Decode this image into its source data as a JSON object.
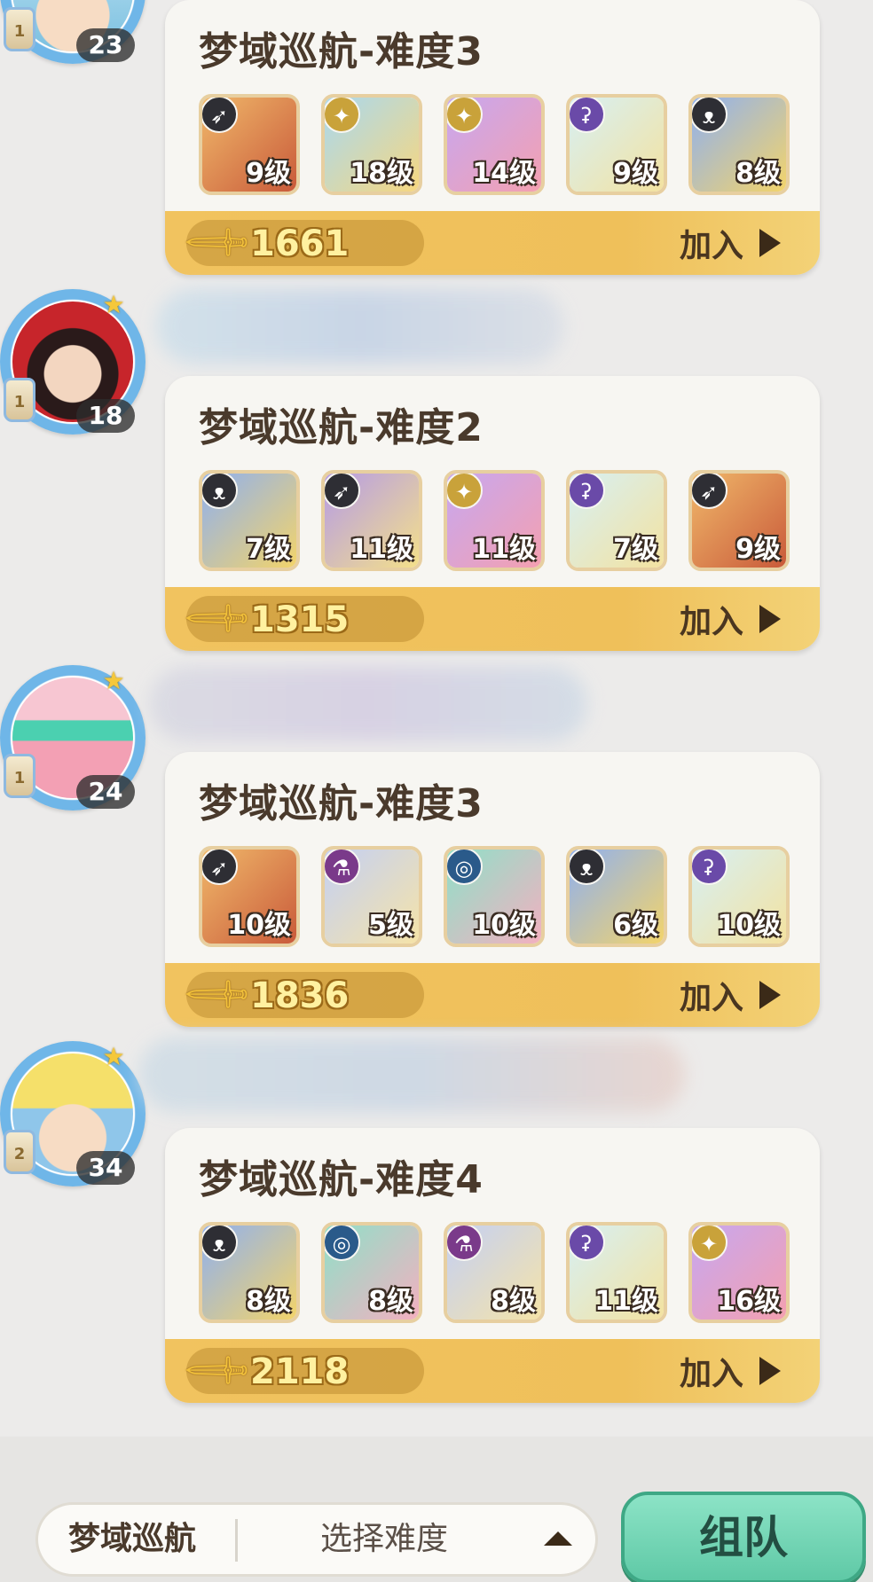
{
  "chat": [
    {
      "sender": {
        "level": "23",
        "bottle": "1"
      },
      "name_blurred": true,
      "card": {
        "title": "梦域巡航-难度3",
        "heroes": [
          {
            "icon": "bow-icon",
            "level": "9级"
          },
          {
            "icon": "wings-icon",
            "level": "18级"
          },
          {
            "icon": "wings-icon",
            "level": "14级"
          },
          {
            "icon": "magic-icon",
            "level": "9级"
          },
          {
            "icon": "cat-icon",
            "level": "8级"
          }
        ],
        "power": "1661",
        "join_label": "加入"
      }
    },
    {
      "sender": {
        "level": "18",
        "bottle": "1"
      },
      "name_blurred": true,
      "card": {
        "title": "梦域巡航-难度2",
        "heroes": [
          {
            "icon": "cat-icon",
            "level": "7级"
          },
          {
            "icon": "bow-icon",
            "level": "11级"
          },
          {
            "icon": "wings-icon",
            "level": "11级"
          },
          {
            "icon": "magic-icon",
            "level": "7级"
          },
          {
            "icon": "bow-icon",
            "level": "9级"
          }
        ],
        "power": "1315",
        "join_label": "加入"
      }
    },
    {
      "sender": {
        "level": "24",
        "bottle": "1"
      },
      "name_blurred": true,
      "card": {
        "title": "梦域巡航-难度3",
        "heroes": [
          {
            "icon": "bow-icon",
            "level": "10级"
          },
          {
            "icon": "potion-icon",
            "level": "5级"
          },
          {
            "icon": "spiral-icon",
            "level": "10级"
          },
          {
            "icon": "cat-icon",
            "level": "6级"
          },
          {
            "icon": "magic-icon",
            "level": "10级"
          }
        ],
        "power": "1836",
        "join_label": "加入"
      }
    },
    {
      "sender": {
        "level": "34",
        "bottle": "2"
      },
      "name_blurred": true,
      "card": {
        "title": "梦域巡航-难度4",
        "heroes": [
          {
            "icon": "cat-icon",
            "level": "8级"
          },
          {
            "icon": "spiral-icon",
            "level": "8级"
          },
          {
            "icon": "potion-icon",
            "level": "8级"
          },
          {
            "icon": "magic-icon",
            "level": "11级"
          },
          {
            "icon": "wings-icon",
            "level": "16级"
          }
        ],
        "power": "2118",
        "join_label": "加入"
      }
    }
  ],
  "bottom_bar": {
    "mode": "梦域巡航",
    "difficulty_placeholder": "选择难度",
    "team_button": "组队"
  },
  "colors": {
    "card_bar": "#efc05a",
    "team_button": "#6fd3b0",
    "title_text": "#4a3a2c"
  }
}
